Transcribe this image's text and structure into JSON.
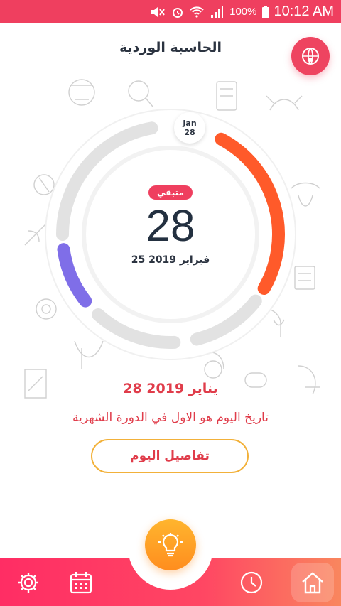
{
  "status_bar": {
    "battery_percent": "100%",
    "time": "10:12 AM"
  },
  "header": {
    "title": "الحاسبة الوردية"
  },
  "cycle": {
    "remaining_label": "متبقي",
    "days_remaining": "28",
    "next_period_date": "25 فبراير 2019",
    "marker_month": "Jan",
    "marker_day": "28"
  },
  "today": {
    "date": "28 يناير 2019",
    "message": "تاريخ اليوم هو الاول في الدورة الشهرية",
    "details_button": "تفاصيل اليوم"
  },
  "colors": {
    "brand": "#ef3f5f",
    "period_arc": "#ff5a2a",
    "fertile_arc": "#7f6ee8",
    "track": "#e2e2e2",
    "accent_gold": "#f2b13a"
  },
  "nav": {
    "items": [
      "settings-icon",
      "calendar-icon",
      "lightbulb-icon",
      "clock-icon",
      "home-icon"
    ],
    "active": "home-icon"
  }
}
